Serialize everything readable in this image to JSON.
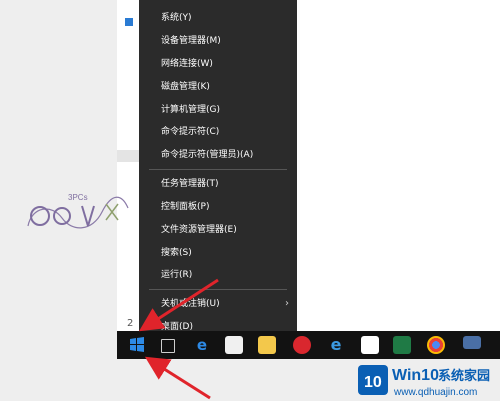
{
  "context_menu": {
    "items": [
      {
        "label": "系统(Y)"
      },
      {
        "label": "设备管理器(M)"
      },
      {
        "label": "网络连接(W)"
      },
      {
        "label": "磁盘管理(K)"
      },
      {
        "label": "计算机管理(G)"
      },
      {
        "label": "命令提示符(C)"
      },
      {
        "label": "命令提示符(管理员)(A)"
      },
      {
        "label": "任务管理器(T)"
      },
      {
        "label": "控制面板(P)"
      },
      {
        "label": "文件资源管理器(E)"
      },
      {
        "label": "搜索(S)"
      },
      {
        "label": "运行(R)"
      },
      {
        "label": "关机或注销(U)",
        "submenu_indicator": "›"
      },
      {
        "label": "桌面(D)"
      }
    ]
  },
  "window": {
    "page_number": "2"
  },
  "watermark": {
    "text": "3PCs"
  },
  "site_logo": {
    "part1": "Win10",
    "part2": "系统家园",
    "url": "www.qdhuajin.com"
  },
  "taskbar": {
    "icons": [
      "windows-start-icon",
      "task-view-icon",
      "edge-icon",
      "store-icon",
      "file-explorer-icon",
      "netease-music-icon",
      "ie-icon",
      "calendar-icon",
      "excel-icon",
      "chrome-icon",
      "monitor-icon"
    ]
  },
  "colors": {
    "menu_bg": "#2b2b2b",
    "taskbar_bg": "#121212",
    "arrow": "#e0242b",
    "logo_blue": "#0a5fb4"
  }
}
